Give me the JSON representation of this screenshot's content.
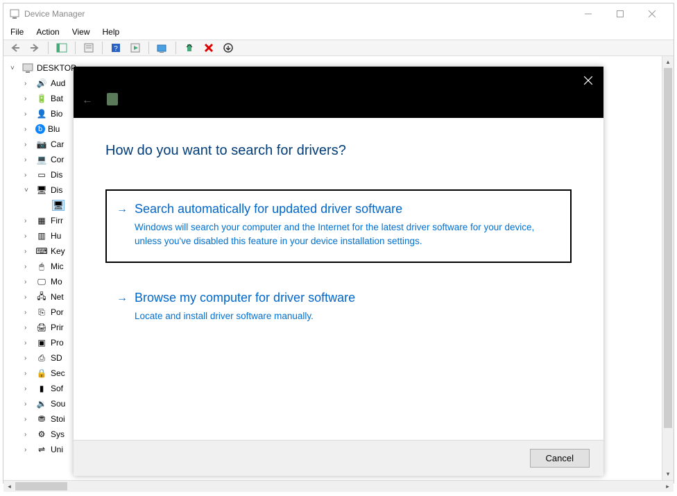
{
  "window": {
    "title": "Device Manager",
    "menu": {
      "file": "File",
      "action": "Action",
      "view": "View",
      "help": "Help"
    }
  },
  "tree": {
    "root": "DESKTOP",
    "items": [
      {
        "label": "Audio",
        "icon": "speaker"
      },
      {
        "label": "Batteries",
        "icon": "battery"
      },
      {
        "label": "Biometric",
        "icon": "bio"
      },
      {
        "label": "Bluetooth",
        "icon": "bluetooth"
      },
      {
        "label": "Cameras",
        "icon": "camera"
      },
      {
        "label": "Computer",
        "icon": "computer"
      },
      {
        "label": "Disk drives",
        "icon": "disk"
      },
      {
        "label": "Display adapters",
        "icon": "display",
        "expanded": true,
        "children": [
          {
            "label": "",
            "icon": "display"
          }
        ]
      },
      {
        "label": "Firmware",
        "icon": "firmware"
      },
      {
        "label": "Human Interface Devices",
        "icon": "hid"
      },
      {
        "label": "Keyboards",
        "icon": "keyboard"
      },
      {
        "label": "Mice",
        "icon": "mouse"
      },
      {
        "label": "Monitors",
        "icon": "monitor"
      },
      {
        "label": "Network adapters",
        "icon": "network"
      },
      {
        "label": "Ports",
        "icon": "port"
      },
      {
        "label": "Print queues",
        "icon": "printer"
      },
      {
        "label": "Processors",
        "icon": "processor"
      },
      {
        "label": "SD host adapters",
        "icon": "sd"
      },
      {
        "label": "Security devices",
        "icon": "security"
      },
      {
        "label": "Software devices",
        "icon": "software"
      },
      {
        "label": "Sound",
        "icon": "sound"
      },
      {
        "label": "Storage",
        "icon": "storage"
      },
      {
        "label": "System devices",
        "icon": "system"
      },
      {
        "label": "Universal",
        "icon": "usb"
      }
    ],
    "visible_labels": [
      "Aud",
      "Bat",
      "Bio",
      "Blu",
      "Car",
      "Cor",
      "Dis",
      "Dis",
      "Firr",
      "Hu",
      "Key",
      "Mic",
      "Mo",
      "Net",
      "Por",
      "Prir",
      "Pro",
      "SD",
      "Sec",
      "Sof",
      "Sou",
      "Stoi",
      "Sys",
      "Uni"
    ]
  },
  "dialog": {
    "heading": "How do you want to search for drivers?",
    "options": [
      {
        "title": "Search automatically for updated driver software",
        "desc": "Windows will search your computer and the Internet for the latest driver software for your device, unless you've disabled this feature in your device installation settings."
      },
      {
        "title": "Browse my computer for driver software",
        "desc": "Locate and install driver software manually."
      }
    ],
    "cancel": "Cancel"
  }
}
